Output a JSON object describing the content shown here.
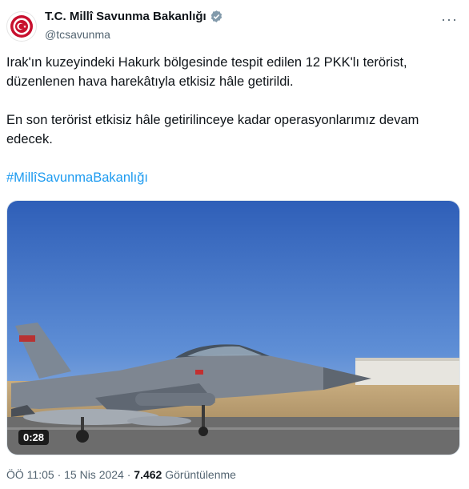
{
  "account": {
    "name": "T.C. Millî Savunma Bakanlığı",
    "handle": "@tcsavunma"
  },
  "tweet": {
    "paragraph_1": "Irak'ın kuzeyindeki Hakurk bölgesinde tespit edilen 12 PKK'lı terörist, düzenlenen hava harekâtıyla etkisiz hâle getirildi.",
    "paragraph_2": "En son terörist etkisiz hâle getirilinceye kadar operasyonlarımız devam edecek.",
    "hashtag": "#MillîSavunmaBakanlığı"
  },
  "media": {
    "duration": "0:28"
  },
  "meta": {
    "time": "ÖÖ 11:05",
    "separator": "·",
    "date": "15 Nis 2024",
    "views_count": "7.462",
    "views_label": "Görüntülenme"
  },
  "icons": {
    "more": "more-icon",
    "verified": "verified-badge-icon"
  },
  "colors": {
    "hashtag": "#1d9bf0",
    "verified": "#829aab",
    "emblem": "#c8102e"
  }
}
